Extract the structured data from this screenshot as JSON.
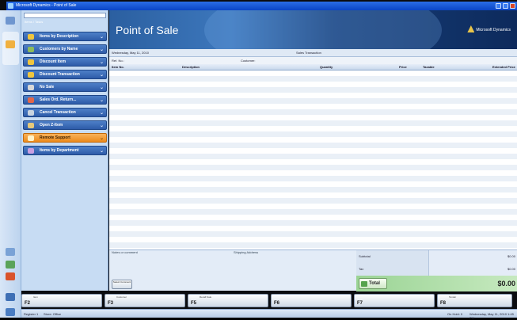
{
  "window": {
    "title": "Microsoft Dynamics - Point of Sale"
  },
  "banner": {
    "title": "Point of Sale",
    "logo_text": "Microsoft Dynamics"
  },
  "sidebar": {
    "search_placeholder": "",
    "hint": "Items / Tasks",
    "items": [
      {
        "label": "Items by Description",
        "style": "blue",
        "icon": "magnifier-icon"
      },
      {
        "label": "Customers by Name",
        "style": "blue",
        "icon": "people-icon"
      },
      {
        "label": "Discount Item",
        "style": "blue",
        "icon": "tag-icon"
      },
      {
        "label": "Discount Transaction",
        "style": "blue",
        "icon": "tag-icon"
      },
      {
        "label": "No Sale",
        "style": "blue",
        "icon": "drawer-icon"
      },
      {
        "label": "Sales Ord. Return...",
        "style": "blue",
        "icon": "return-icon"
      },
      {
        "label": "Cancel Transaction",
        "style": "blue",
        "icon": "cancel-icon"
      },
      {
        "label": "Open Z-Item",
        "style": "blue",
        "icon": "box-icon"
      },
      {
        "label": "Remote Support",
        "style": "orange",
        "icon": "support-icon"
      },
      {
        "label": "Items by Department",
        "style": "blue",
        "icon": "folder-icon"
      }
    ]
  },
  "info": {
    "date": "Wednesday, May 11, 2010",
    "center": "Sales Transaction",
    "ref": "Ref. No.:",
    "customer": "Customer:"
  },
  "table": {
    "columns": [
      "Item No.",
      "Description",
      "Quantity",
      "Price",
      "Taxable",
      "Extended Price"
    ],
    "rows": []
  },
  "bottom": {
    "comment_label": "Notes or comment",
    "shipping_label": "Shipping Address",
    "button_label": "Select Comment"
  },
  "totals": {
    "subtotal_label": "Subtotal",
    "subtotal_value": "$0.00",
    "tax_label": "Tax",
    "tax_value": "$0.00",
    "total_label": "Total",
    "total_value": "$0.00"
  },
  "fkeys": [
    {
      "key": "F2",
      "caption": "Item"
    },
    {
      "key": "F3",
      "caption": "Customer"
    },
    {
      "key": "F5",
      "caption": "Recall Sale"
    },
    {
      "key": "F6",
      "caption": ""
    },
    {
      "key": "F7",
      "caption": ""
    },
    {
      "key": "F8",
      "caption": "Tender"
    }
  ],
  "status": {
    "left": "Register 1",
    "user": "Store: Office",
    "right1": "On Hold: 0",
    "right2": "Wednesday, May 11, 2010 1:45 PM"
  }
}
